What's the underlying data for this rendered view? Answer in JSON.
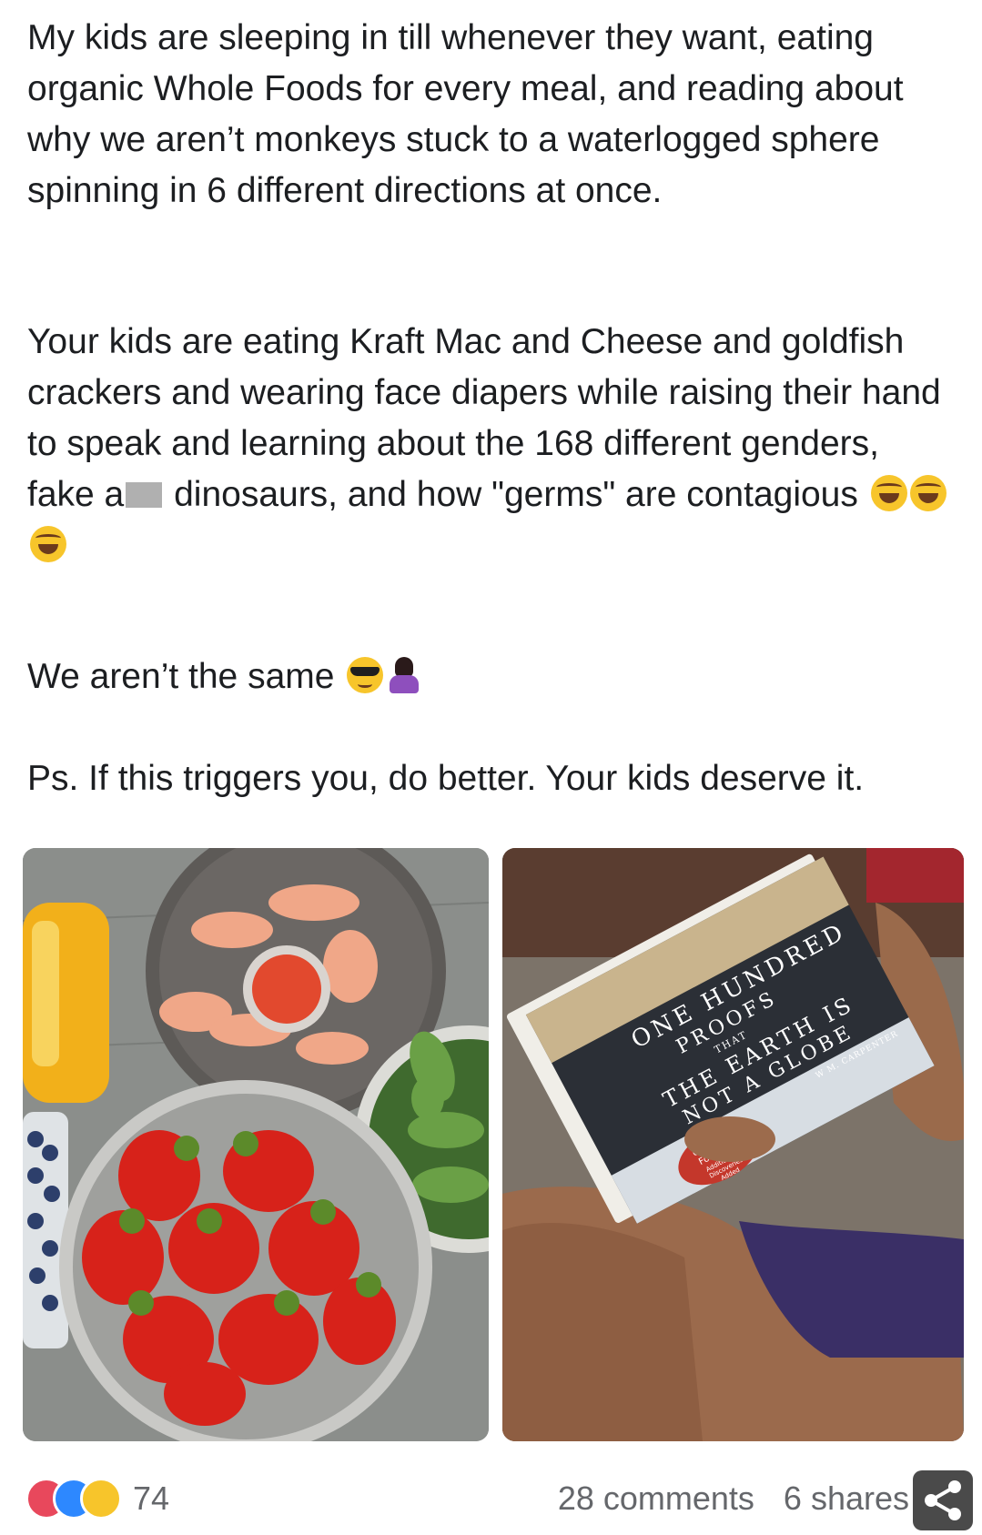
{
  "post": {
    "paragraph1": "My kids are sleeping in till whenever they want, eating organic Whole Foods for every meal, and reading about why we aren’t monkeys stuck to a waterlogged sphere spinning in 6 different directions at once.",
    "paragraph2_before_censor": "Your kids are eating Kraft Mac and Cheese and goldfish crackers and wearing face diapers while raising their hand to speak and learning about the 168 different genders, fake a",
    "paragraph2_after_censor": " dinosaurs, and how \"germs\" are contagious",
    "paragraph2_emojis": [
      "rolling-on-floor-laughing",
      "rolling-on-floor-laughing",
      "rolling-on-floor-laughing"
    ],
    "paragraph3": "We aren’t the same",
    "paragraph3_emojis": [
      "smiling-face-with-sunglasses",
      "person-shrugging"
    ],
    "paragraph4": "Ps. If this triggers you, do better. Your kids deserve it."
  },
  "photos": {
    "food": {
      "icon": "food-photo"
    },
    "book": {
      "icon": "book-photo",
      "title_line1": "ONE HUNDRED",
      "title_line2": "PROOFS",
      "title_line3": "THAT",
      "title_line4": "THE EARTH IS",
      "title_line5": "NOT A GLOBE",
      "author": "W M. CARPENTER",
      "badge_line1": "Updated",
      "badge_line2": "For 2017!",
      "badge_line3": "Additional",
      "badge_line4": "Discoveries",
      "badge_line5": "Added"
    }
  },
  "footer": {
    "reaction_icons": [
      "love-icon",
      "like-icon",
      "haha-icon"
    ],
    "reaction_count": "74",
    "comments": "28 comments",
    "shares": "6 shares",
    "share_icon": "share-icon"
  },
  "colors": {
    "text": "#1c1e21",
    "muted": "#65676b",
    "love": "#e8485c",
    "like": "#2d88ff",
    "haha": "#f7c52b"
  }
}
